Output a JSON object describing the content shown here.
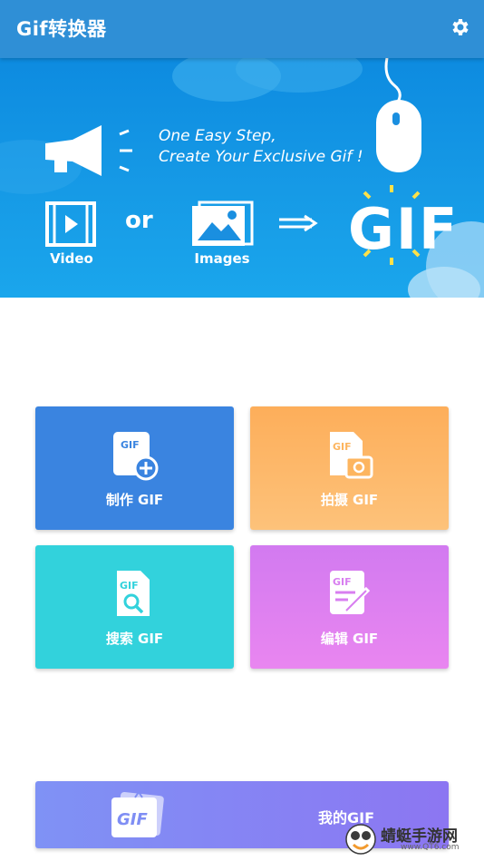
{
  "appbar": {
    "title": "Gif转换器"
  },
  "banner": {
    "line1": "One Easy Step,",
    "line2": "Create Your Exclusive Gif !",
    "video_label": "Video",
    "or_label": "or",
    "images_label": "Images",
    "gif_label": "GIF"
  },
  "actions": [
    {
      "label": "制作 GIF",
      "icon": "gif-file-plus-icon",
      "color": "#3a84e0"
    },
    {
      "label": "拍摄 GIF",
      "icon": "gif-file-camera-icon",
      "color": "#fdb55f"
    },
    {
      "label": "搜索 GIF",
      "icon": "gif-file-search-icon",
      "color": "#32d2dc"
    },
    {
      "label": "编辑 GIF",
      "icon": "gif-file-edit-icon",
      "color": "#e07ef0"
    }
  ],
  "my_gif": {
    "label": "我的GIF",
    "icon_text": "GIF"
  },
  "watermark": {
    "text": "蜻蜓手游网",
    "url": "www.QT6.com"
  }
}
